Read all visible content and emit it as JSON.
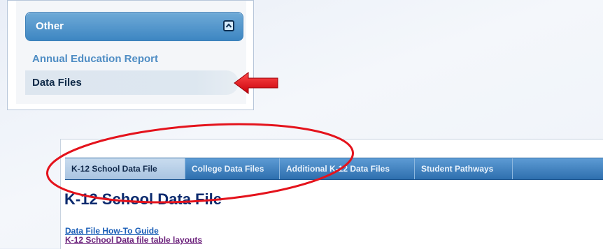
{
  "sidebar": {
    "section_title": "Other",
    "items": [
      {
        "label": "Annual Education Report"
      },
      {
        "label": "Data Files",
        "selected": true
      }
    ],
    "collapse_icon": "chevron-up-icon"
  },
  "tabs": [
    {
      "label": "K-12 School Data File",
      "active": true
    },
    {
      "label": "College Data Files",
      "active": false
    },
    {
      "label": "Additional K-12 Data Files",
      "active": false
    },
    {
      "label": "Student Pathways",
      "active": false
    }
  ],
  "page": {
    "heading": "K-12 School Data File",
    "links": [
      {
        "label": "Data File How-To Guide"
      },
      {
        "label": "K-12 School Data file table layouts"
      }
    ]
  },
  "colors": {
    "accent_blue": "#3d86c2",
    "annotation_red": "#e4131c"
  }
}
